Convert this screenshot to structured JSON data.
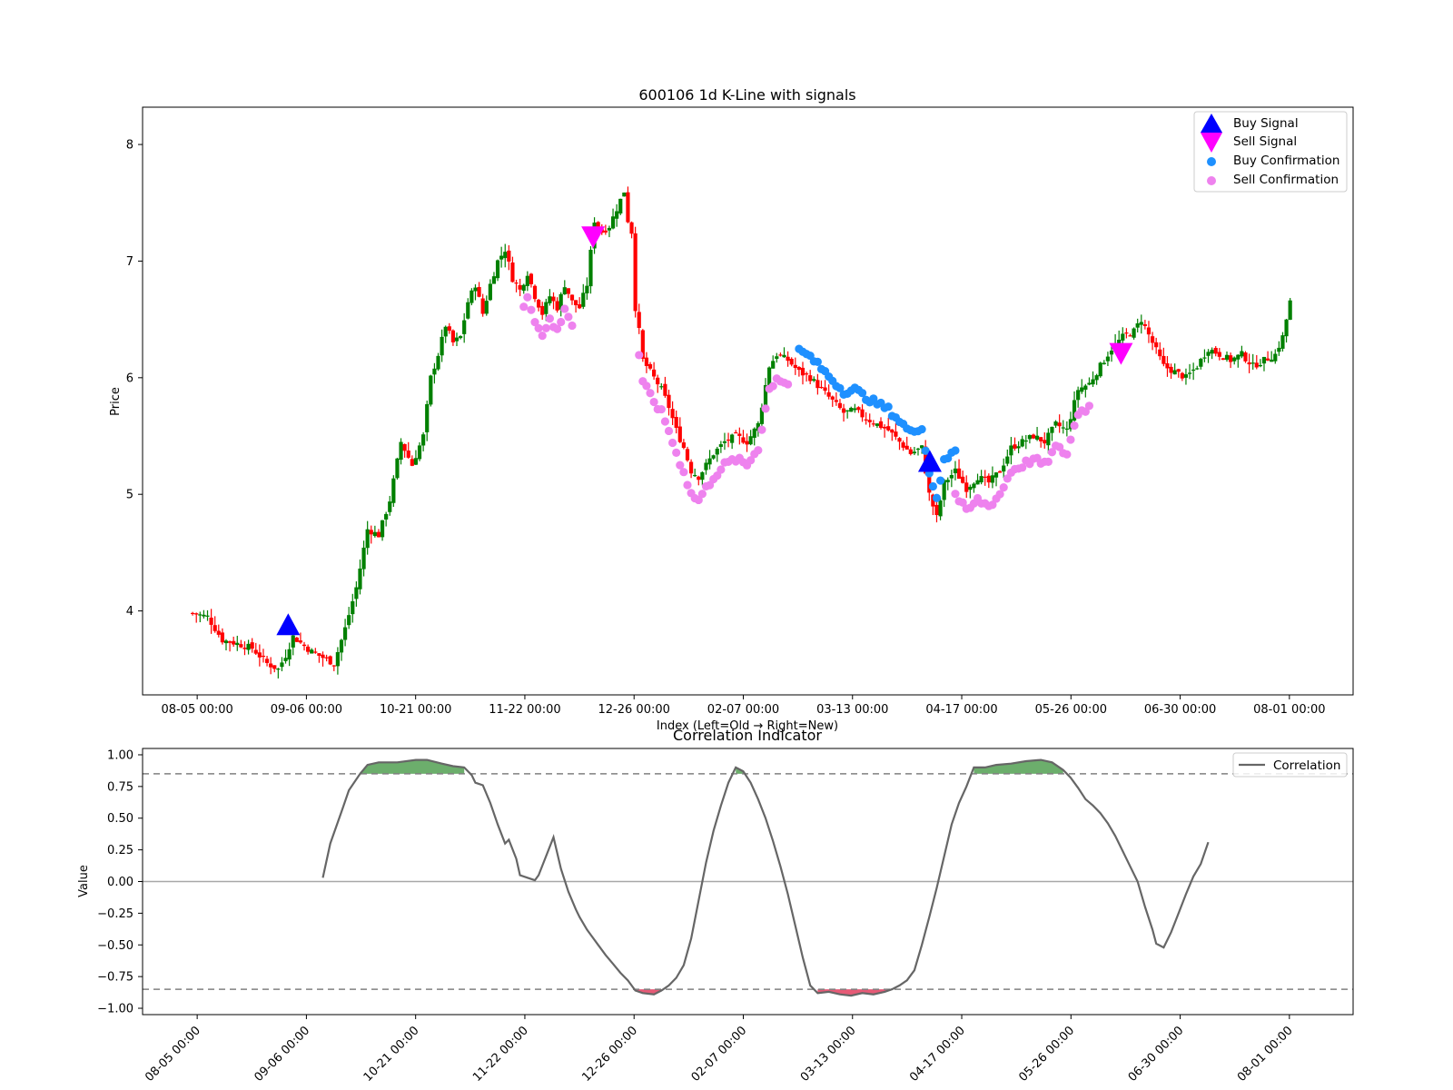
{
  "chart_data": [
    {
      "type": "candlestick",
      "title": "600106 1d K-Line with signals",
      "xlabel": "Index (Left=Old → Right=New)",
      "ylabel": "Price",
      "ylim": [
        3.28,
        8.32
      ],
      "yticks": [
        4,
        5,
        6,
        7,
        8
      ],
      "x_range": [
        -11,
        255
      ],
      "xticks": [
        {
          "i": 1,
          "label": "08-05 00:00"
        },
        {
          "i": 25,
          "label": "09-06 00:00"
        },
        {
          "i": 49,
          "label": "10-21 00:00"
        },
        {
          "i": 73,
          "label": "11-22 00:00"
        },
        {
          "i": 97,
          "label": "12-26 00:00"
        },
        {
          "i": 121,
          "label": "02-07 00:00"
        },
        {
          "i": 145,
          "label": "03-13 00:00"
        },
        {
          "i": 169,
          "label": "04-17 00:00"
        },
        {
          "i": 193,
          "label": "05-26 00:00"
        },
        {
          "i": 217,
          "label": "06-30 00:00"
        },
        {
          "i": 241,
          "label": "08-01 00:00"
        }
      ],
      "up_color": "#008000",
      "down_color": "#ff0000",
      "grid": false,
      "legend_position": "upper right",
      "legend": [
        {
          "name": "Buy Signal",
          "marker": "triangle-up",
          "color": "#0000ff"
        },
        {
          "name": "Sell Signal",
          "marker": "triangle-down",
          "color": "#ff00ff"
        },
        {
          "name": "Buy Confirmation",
          "marker": "circle",
          "color": "#1e90ff"
        },
        {
          "name": "Sell Confirmation",
          "marker": "circle",
          "color": "#ee82ee"
        }
      ],
      "close_anchors": [
        [
          0,
          3.98
        ],
        [
          4,
          3.95
        ],
        [
          8,
          3.75
        ],
        [
          12,
          3.72
        ],
        [
          16,
          3.68
        ],
        [
          20,
          3.55
        ],
        [
          23,
          3.5
        ],
        [
          25,
          3.62
        ],
        [
          27,
          3.78
        ],
        [
          30,
          3.7
        ],
        [
          32,
          3.65
        ],
        [
          35,
          3.6
        ],
        [
          38,
          3.55
        ],
        [
          41,
          3.85
        ],
        [
          44,
          4.2
        ],
        [
          47,
          4.7
        ],
        [
          50,
          4.65
        ],
        [
          53,
          4.95
        ],
        [
          56,
          5.45
        ],
        [
          59,
          5.25
        ],
        [
          62,
          5.5
        ],
        [
          64,
          6.0
        ],
        [
          66,
          6.2
        ],
        [
          68,
          6.45
        ],
        [
          70,
          6.3
        ],
        [
          72,
          6.35
        ],
        [
          74,
          6.65
        ],
        [
          76,
          6.8
        ],
        [
          78,
          6.55
        ],
        [
          80,
          6.8
        ],
        [
          82,
          7.0
        ],
        [
          84,
          7.1
        ],
        [
          86,
          6.85
        ],
        [
          88,
          6.75
        ],
        [
          90,
          6.9
        ],
        [
          92,
          6.7
        ],
        [
          94,
          6.55
        ],
        [
          96,
          6.7
        ],
        [
          98,
          6.6
        ],
        [
          100,
          6.8
        ],
        [
          102,
          6.65
        ],
        [
          104,
          6.6
        ],
        [
          106,
          6.8
        ],
        [
          108,
          7.35
        ],
        [
          110,
          7.25
        ],
        [
          112,
          7.3
        ],
        [
          114,
          7.45
        ],
        [
          116,
          7.6
        ],
        [
          117,
          7.35
        ],
        [
          118,
          7.25
        ],
        [
          119,
          6.6
        ],
        [
          120,
          6.4
        ],
        [
          121,
          6.15
        ],
        [
          123,
          6.05
        ],
        [
          126,
          5.9
        ],
        [
          128,
          5.75
        ],
        [
          130,
          5.55
        ],
        [
          132,
          5.4
        ],
        [
          134,
          5.2
        ],
        [
          136,
          5.15
        ],
        [
          138,
          5.25
        ],
        [
          140,
          5.35
        ],
        [
          143,
          5.45
        ],
        [
          146,
          5.5
        ],
        [
          149,
          5.45
        ],
        [
          152,
          5.6
        ],
        [
          155,
          6.1
        ],
        [
          157,
          6.2
        ],
        [
          160,
          6.15
        ],
        [
          163,
          6.05
        ],
        [
          166,
          6.0
        ],
        [
          169,
          5.9
        ],
        [
          172,
          5.8
        ],
        [
          175,
          5.7
        ],
        [
          178,
          5.72
        ],
        [
          181,
          5.65
        ],
        [
          184,
          5.6
        ],
        [
          187,
          5.55
        ],
        [
          190,
          5.45
        ],
        [
          193,
          5.35
        ],
        [
          196,
          5.4
        ],
        [
          198,
          5.0
        ],
        [
          200,
          4.8
        ],
        [
          202,
          5.1
        ],
        [
          205,
          5.2
        ],
        [
          208,
          5.05
        ],
        [
          211,
          5.15
        ],
        [
          214,
          5.1
        ],
        [
          217,
          5.2
        ],
        [
          220,
          5.4
        ],
        [
          223,
          5.45
        ],
        [
          226,
          5.5
        ],
        [
          229,
          5.45
        ],
        [
          232,
          5.6
        ],
        [
          235,
          5.55
        ],
        [
          238,
          5.9
        ],
        [
          241,
          5.95
        ],
        [
          244,
          6.1
        ],
        [
          247,
          6.25
        ],
        [
          250,
          6.35
        ],
        [
          253,
          6.4
        ],
        [
          255,
          6.5
        ],
        [
          258,
          6.3
        ],
        [
          261,
          6.1
        ],
        [
          264,
          6.05
        ],
        [
          267,
          6.0
        ],
        [
          270,
          6.1
        ],
        [
          273,
          6.25
        ],
        [
          276,
          6.2
        ],
        [
          279,
          6.15
        ],
        [
          282,
          6.2
        ],
        [
          285,
          6.1
        ],
        [
          288,
          6.15
        ],
        [
          291,
          6.2
        ],
        [
          293,
          6.35
        ],
        [
          295,
          6.65
        ]
      ],
      "signals": {
        "buy": [
          [
            21,
            3.87
          ],
          [
            162,
            5.27
          ]
        ],
        "sell": [
          [
            88,
            7.22
          ],
          [
            204,
            6.22
          ]
        ]
      },
      "confirmations": {
        "buy_range": [
          163,
          205
        ],
        "sell_ranges": [
          [
            89,
            102
          ],
          [
            120,
            160
          ],
          [
            205,
            241
          ]
        ]
      }
    },
    {
      "type": "line",
      "title": "Correlation Indicator",
      "xlabel": "",
      "ylabel": "Value",
      "ylim": [
        -1.05,
        1.05
      ],
      "yticks": [
        1.0,
        0.75,
        0.5,
        0.25,
        0.0,
        -0.25,
        -0.5,
        -0.75,
        -1.0
      ],
      "ytick_labels": [
        "1.00",
        "0.75",
        "0.50",
        "0.25",
        "0.00",
        "−0.25",
        "−0.50",
        "−0.75",
        "−1.00"
      ],
      "x_range": [
        -11,
        255
      ],
      "xticks": [
        {
          "i": 1,
          "label": "08-05 00:00"
        },
        {
          "i": 25,
          "label": "09-06 00:00"
        },
        {
          "i": 49,
          "label": "10-21 00:00"
        },
        {
          "i": 73,
          "label": "11-22 00:00"
        },
        {
          "i": 97,
          "label": "12-26 00:00"
        },
        {
          "i": 121,
          "label": "02-07 00:00"
        },
        {
          "i": 145,
          "label": "03-13 00:00"
        },
        {
          "i": 169,
          "label": "04-17 00:00"
        },
        {
          "i": 193,
          "label": "05-26 00:00"
        },
        {
          "i": 217,
          "label": "06-30 00:00"
        },
        {
          "i": 241,
          "label": "08-01 00:00"
        }
      ],
      "thresholds": {
        "upper": 0.85,
        "lower": -0.85,
        "zero": 0.0
      },
      "line_color": "#666666",
      "fill_pos_color": "#2e8b2e",
      "fill_neg_color": "#dc143c",
      "legend_position": "upper right",
      "series": [
        {
          "name": "Correlation",
          "points": [
            [
              35,
              0.03
            ],
            [
              37,
              0.3
            ],
            [
              40,
              0.55
            ],
            [
              42,
              0.72
            ],
            [
              45,
              0.85
            ],
            [
              47,
              0.92
            ],
            [
              50,
              0.94
            ],
            [
              55,
              0.94
            ],
            [
              60,
              0.96
            ],
            [
              63,
              0.96
            ],
            [
              67,
              0.93
            ],
            [
              70,
              0.91
            ],
            [
              73,
              0.9
            ],
            [
              75,
              0.84
            ],
            [
              76,
              0.78
            ],
            [
              78,
              0.76
            ],
            [
              80,
              0.62
            ],
            [
              82,
              0.45
            ],
            [
              84,
              0.3
            ],
            [
              85,
              0.33
            ],
            [
              87,
              0.18
            ],
            [
              88,
              0.05
            ],
            [
              90,
              0.03
            ],
            [
              92,
              0.01
            ],
            [
              93,
              0.05
            ],
            [
              95,
              0.2
            ],
            [
              97,
              0.35
            ],
            [
              99,
              0.1
            ],
            [
              101,
              -0.08
            ],
            [
              103,
              -0.22
            ],
            [
              104,
              -0.28
            ],
            [
              106,
              -0.38
            ],
            [
              107,
              -0.42
            ],
            [
              109,
              -0.5
            ],
            [
              111,
              -0.58
            ],
            [
              113,
              -0.65
            ],
            [
              115,
              -0.72
            ],
            [
              117,
              -0.78
            ],
            [
              118,
              -0.82
            ],
            [
              119,
              -0.86
            ],
            [
              121,
              -0.88
            ],
            [
              124,
              -0.89
            ],
            [
              126,
              -0.86
            ],
            [
              128,
              -0.82
            ],
            [
              130,
              -0.76
            ],
            [
              132,
              -0.66
            ],
            [
              134,
              -0.45
            ],
            [
              136,
              -0.15
            ],
            [
              138,
              0.15
            ],
            [
              140,
              0.4
            ],
            [
              142,
              0.6
            ],
            [
              144,
              0.78
            ],
            [
              146,
              0.9
            ],
            [
              148,
              0.87
            ],
            [
              150,
              0.78
            ],
            [
              152,
              0.65
            ],
            [
              154,
              0.5
            ],
            [
              156,
              0.32
            ],
            [
              158,
              0.12
            ],
            [
              160,
              -0.1
            ],
            [
              162,
              -0.35
            ],
            [
              164,
              -0.6
            ],
            [
              166,
              -0.82
            ],
            [
              168,
              -0.88
            ],
            [
              171,
              -0.87
            ],
            [
              174,
              -0.89
            ],
            [
              177,
              -0.9
            ],
            [
              180,
              -0.88
            ],
            [
              183,
              -0.89
            ],
            [
              186,
              -0.87
            ],
            [
              188,
              -0.85
            ],
            [
              190,
              -0.82
            ],
            [
              192,
              -0.78
            ],
            [
              194,
              -0.7
            ],
            [
              196,
              -0.5
            ],
            [
              198,
              -0.28
            ],
            [
              200,
              -0.05
            ],
            [
              202,
              0.2
            ],
            [
              204,
              0.45
            ],
            [
              206,
              0.62
            ],
            [
              208,
              0.75
            ],
            [
              210,
              0.9
            ],
            [
              213,
              0.9
            ],
            [
              216,
              0.92
            ],
            [
              220,
              0.93
            ],
            [
              224,
              0.95
            ],
            [
              228,
              0.96
            ],
            [
              231,
              0.94
            ],
            [
              234,
              0.88
            ],
            [
              236,
              0.82
            ],
            [
              238,
              0.74
            ],
            [
              240,
              0.65
            ],
            [
              242,
              0.6
            ],
            [
              244,
              0.54
            ],
            [
              246,
              0.46
            ],
            [
              248,
              0.36
            ],
            [
              250,
              0.24
            ],
            [
              252,
              0.12
            ],
            [
              254,
              0.0
            ],
            [
              256,
              -0.2
            ],
            [
              258,
              -0.38
            ],
            [
              259,
              -0.49
            ],
            [
              261,
              -0.52
            ],
            [
              263,
              -0.4
            ],
            [
              265,
              -0.25
            ],
            [
              267,
              -0.1
            ],
            [
              269,
              0.04
            ],
            [
              271,
              0.14
            ],
            [
              273,
              0.31
            ]
          ]
        }
      ]
    }
  ]
}
